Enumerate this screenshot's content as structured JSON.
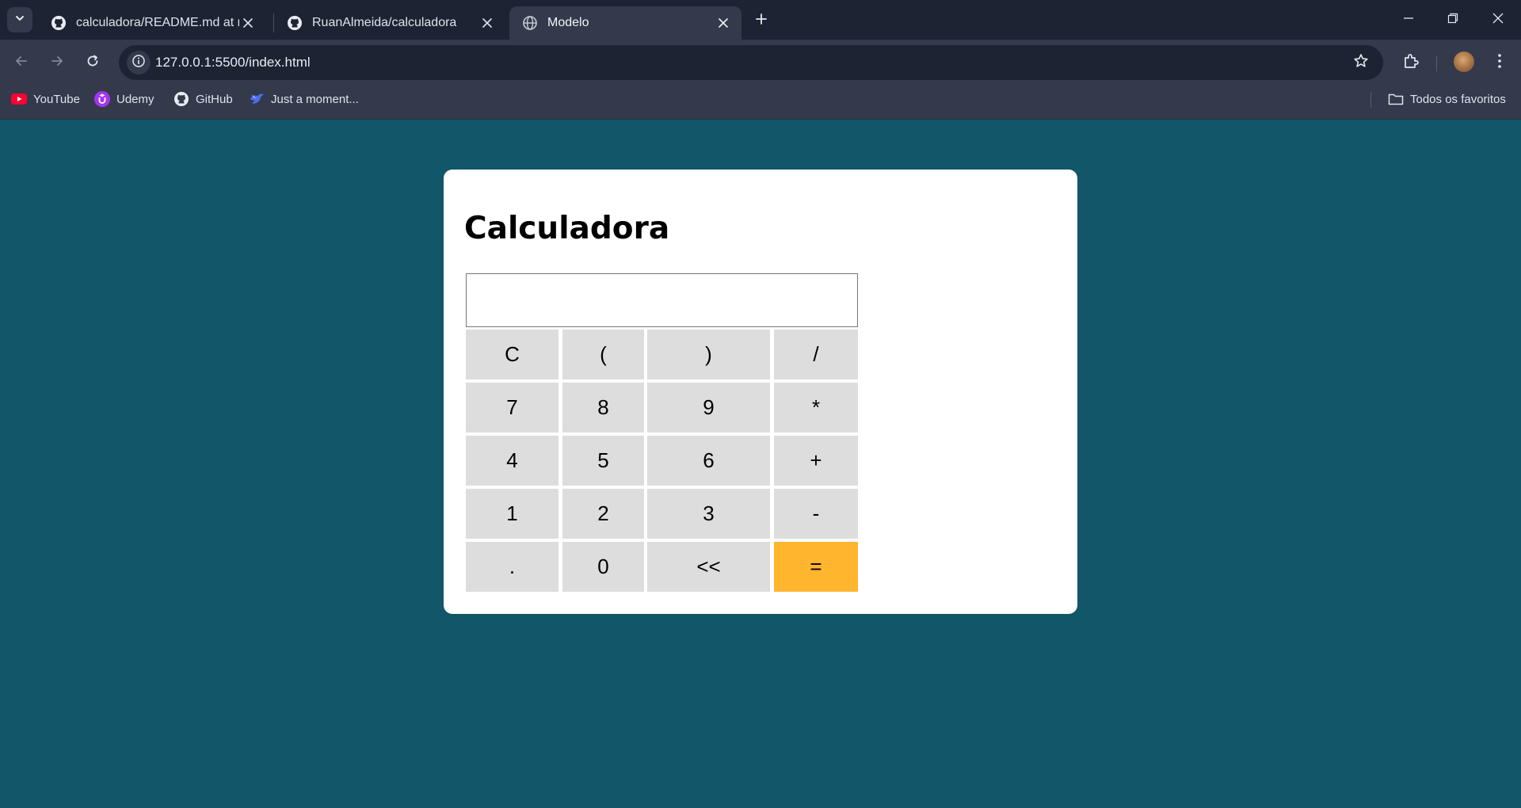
{
  "browser": {
    "tabs": [
      {
        "title": "calculadora/README.md at main · RuanAlmeida/calculadora",
        "icon": "github-icon",
        "active": false
      },
      {
        "title": "RuanAlmeida/calculadora",
        "icon": "github-icon",
        "active": false
      },
      {
        "title": "Modelo",
        "icon": "globe-icon",
        "active": true
      }
    ],
    "url": "127.0.0.1:5500/index.html",
    "bookmarks": [
      {
        "label": "YouTube",
        "icon": "youtube-icon"
      },
      {
        "label": "Udemy",
        "icon": "udemy-icon"
      },
      {
        "label": "GitHub",
        "icon": "github-icon"
      },
      {
        "label": "Just a moment...",
        "icon": "bird-icon"
      }
    ],
    "all_bookmarks_label": "Todos os favoritos"
  },
  "calculator": {
    "title": "Calculadora",
    "display_value": "",
    "rows": [
      [
        "C",
        "(",
        ")",
        "/"
      ],
      [
        "7",
        "8",
        "9",
        "*"
      ],
      [
        "4",
        "5",
        "6",
        "+"
      ],
      [
        "1",
        "2",
        "3",
        "-"
      ],
      [
        ".",
        "0",
        "<<",
        "="
      ]
    ],
    "colors": {
      "page_background": "#12566a",
      "card": "#ffffff",
      "key": "#dddddd",
      "equals_key": "#ffb52e"
    }
  }
}
